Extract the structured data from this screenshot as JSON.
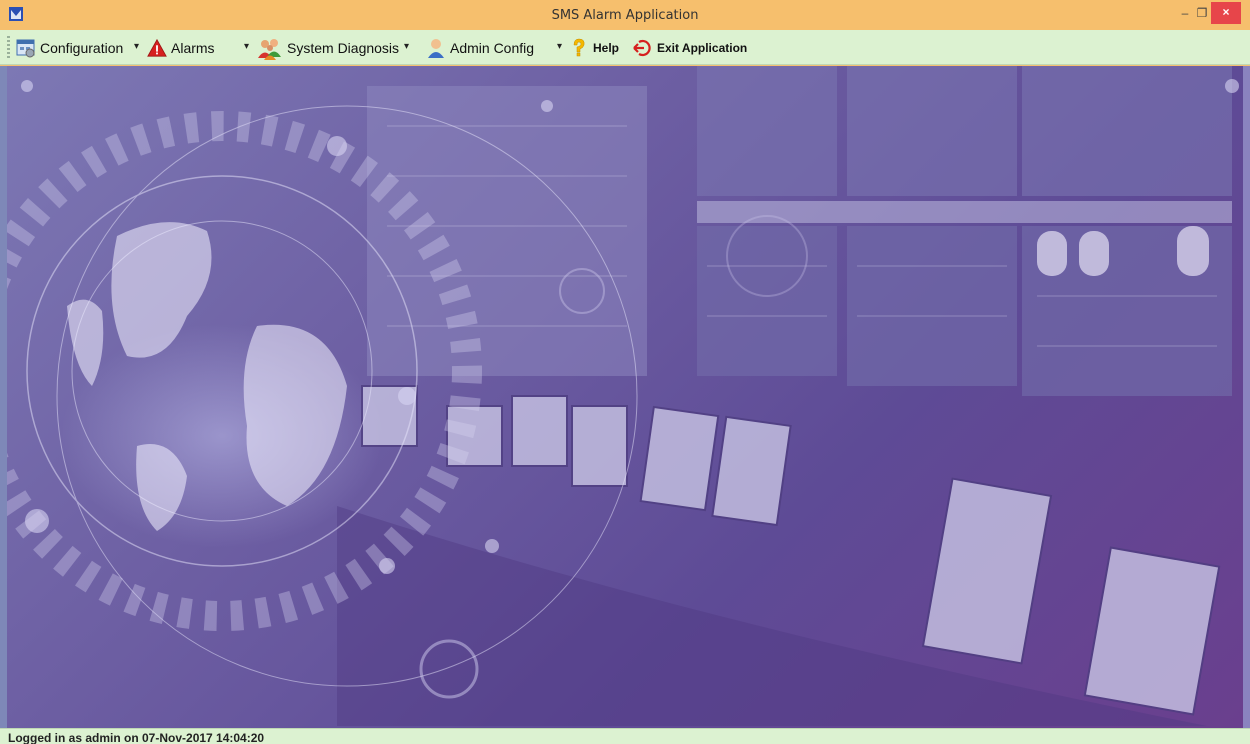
{
  "window": {
    "title": "SMS Alarm Application",
    "minimize_glyph": "–",
    "maximize_glyph": "❐",
    "close_glyph": "×"
  },
  "menu": {
    "configuration": {
      "label": "Configuration",
      "icon": "calendar-window-icon",
      "dropdown": "▾"
    },
    "alarms": {
      "label": "Alarms",
      "icon": "warning-triangle-icon",
      "dropdown": "▾"
    },
    "system_diagnosis": {
      "label": "System Diagnosis",
      "icon": "users-group-icon",
      "dropdown": "▾"
    },
    "admin_config": {
      "label": "Admin Config",
      "icon": "admin-user-icon",
      "dropdown": "▾"
    },
    "help": {
      "label": "Help",
      "icon": "question-mark-icon",
      "dropdown": "▾"
    },
    "exit": {
      "label": "Exit Application",
      "icon": "exit-circle-arrow-icon"
    }
  },
  "status": {
    "text": "Logged in as admin on 07-Nov-2017 14:04:20"
  },
  "colors": {
    "titlebar": "#f6bf6d",
    "menubar": "#dcf2d1",
    "close": "#e7454a",
    "background_purple": "#6d5fa3",
    "alarm_red": "#d6201f"
  }
}
